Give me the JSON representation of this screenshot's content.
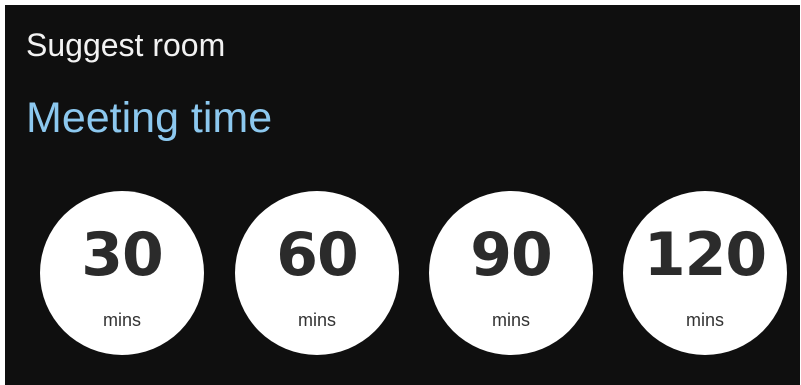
{
  "header": {
    "title": "Suggest room"
  },
  "section": {
    "title": "Meeting time"
  },
  "durations": [
    {
      "value": "30",
      "unit": "mins"
    },
    {
      "value": "60",
      "unit": "mins"
    },
    {
      "value": "90",
      "unit": "mins"
    },
    {
      "value": "120",
      "unit": "mins"
    }
  ],
  "colors": {
    "background": "#0f0f0f",
    "header_text": "#f2f2f2",
    "accent": "#8cc8ef",
    "option_fill": "#ffffff",
    "option_text": "#2b2b2b"
  }
}
